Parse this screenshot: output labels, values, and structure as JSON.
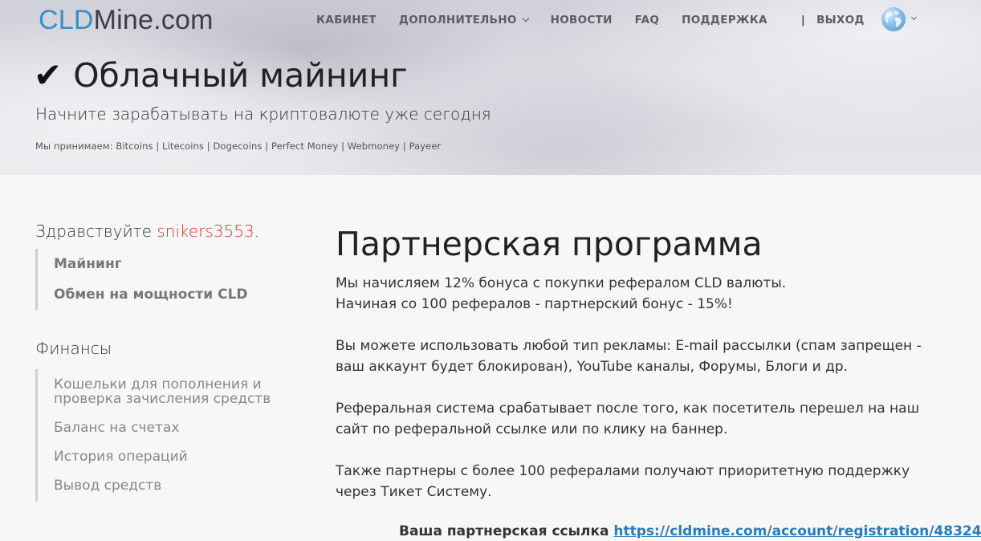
{
  "header": {
    "logo_part1": "CLD",
    "logo_part2": "Mine.com",
    "nav": [
      {
        "label": "КАБИНЕТ"
      },
      {
        "label": "ДОПОЛНИТЕЛЬНО"
      },
      {
        "label": "НОВОСТИ"
      },
      {
        "label": "FAQ"
      },
      {
        "label": "ПОДДЕРЖКА"
      },
      {
        "label": "ВЫХОД"
      }
    ],
    "separator": "|",
    "language_icon": "globe-icon"
  },
  "hero": {
    "check": "✔",
    "title": "Облачный майнинг",
    "subtitle": "Начните зарабатывать на криптовалюте уже сегодня",
    "accept": "Мы принимаем: Bitcoins | Litecoins | Dogecoins | Perfect Money | Webmoney | Payeer"
  },
  "sidebar": {
    "greeting_prefix": "Здравствуйте ",
    "username": "snikers3553",
    "greeting_suffix": ".",
    "group1": [
      {
        "label": "Майнинг"
      },
      {
        "label": "Обмен на мощности CLD"
      }
    ],
    "finance_title": "Финансы",
    "finance": [
      {
        "label": "Кошельки для пополнения и проверка зачисления средств"
      },
      {
        "label": "Баланс на счетах"
      },
      {
        "label": "История операций"
      },
      {
        "label": "Вывод средств"
      }
    ]
  },
  "main": {
    "title": "Партнерская программа",
    "p1_line1": "Мы начисляем 12% бонуса с покупки рефералом CLD валюты.",
    "p1_line2": "Начиная со 100 рефералов - партнерский бонус - 15%!",
    "p2": "Вы можете использовать любой тип рекламы: E-mail рассылки (спам запрещен - ваш аккаунт будет блокирован), YouTube каналы, Форумы, Блоги и др.",
    "p3": "Реферальная система срабатывает после того, как посетитель перешел на наш сайт по реферальной ссылке или по клику на баннер.",
    "p4": "Также партнеры с более 100 рефералами получают приоритетную поддержку через Тикет Систему.",
    "ref_label": "Ваша партнерская ссылка",
    "ref_link": "https://cldmine.com/account/registration/48324"
  }
}
